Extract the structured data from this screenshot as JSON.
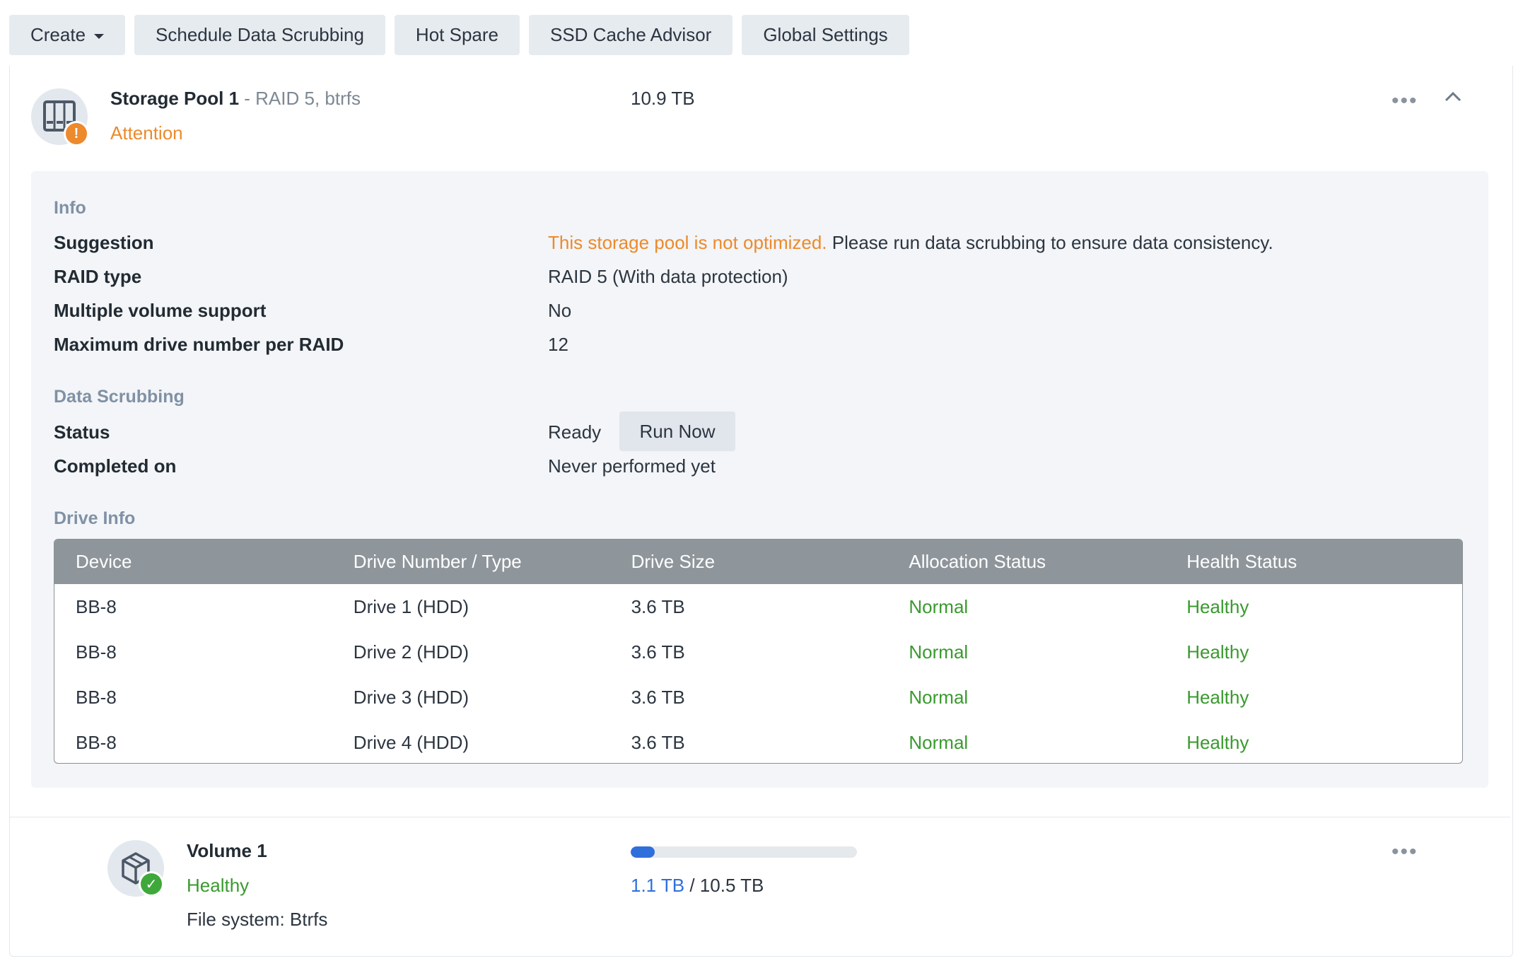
{
  "toolbar": {
    "create_label": "Create",
    "schedule_label": "Schedule Data Scrubbing",
    "hot_spare_label": "Hot Spare",
    "ssd_cache_label": "SSD Cache Advisor",
    "global_settings_label": "Global Settings"
  },
  "pool": {
    "name": "Storage Pool 1",
    "subtitle": " - RAID 5, btrfs",
    "status": "Attention",
    "size": "10.9 TB",
    "more_label": "•••",
    "info": {
      "section_title": "Info",
      "suggestion_label": "Suggestion",
      "suggestion_warning": "This storage pool is not optimized.",
      "suggestion_text": " Please run data scrubbing to ensure data consistency.",
      "raid_type_label": "RAID type",
      "raid_type_value": "RAID 5 (With data protection)",
      "multi_volume_label": "Multiple volume support",
      "multi_volume_value": "No",
      "max_drive_label": "Maximum drive number per RAID",
      "max_drive_value": "12"
    },
    "scrubbing": {
      "section_title": "Data Scrubbing",
      "status_label": "Status",
      "status_value": "Ready",
      "run_now_label": "Run Now",
      "completed_label": "Completed on",
      "completed_value": "Never performed yet"
    },
    "drive_info": {
      "section_title": "Drive Info",
      "columns": [
        "Device",
        "Drive Number / Type",
        "Drive Size",
        "Allocation Status",
        "Health Status"
      ],
      "rows": [
        [
          "BB-8",
          "Drive 1 (HDD)",
          "3.6 TB",
          "Normal",
          "Healthy"
        ],
        [
          "BB-8",
          "Drive 2 (HDD)",
          "3.6 TB",
          "Normal",
          "Healthy"
        ],
        [
          "BB-8",
          "Drive 3 (HDD)",
          "3.6 TB",
          "Normal",
          "Healthy"
        ],
        [
          "BB-8",
          "Drive 4 (HDD)",
          "3.6 TB",
          "Normal",
          "Healthy"
        ]
      ]
    }
  },
  "volume": {
    "name": "Volume 1",
    "status": "Healthy",
    "filesystem": "File system: Btrfs",
    "used": "1.1 TB",
    "separator": " / ",
    "total": "10.5 TB",
    "usage_fraction": 0.105,
    "more_label": "•••"
  },
  "colors": {
    "warning": "#ec8a2c",
    "healthy": "#3a9a2f",
    "accent_blue": "#2f6fdb",
    "table_header": "#8e959b"
  }
}
